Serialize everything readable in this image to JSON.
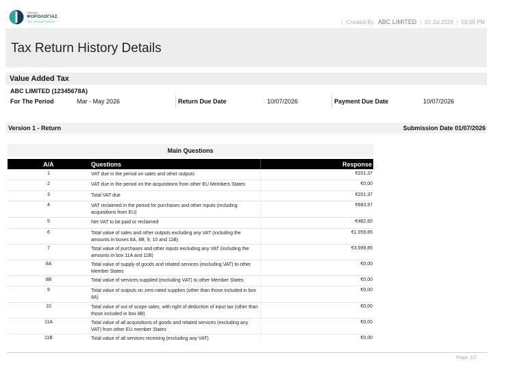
{
  "header": {
    "logo": {
      "line1": "ΤΜΗΜΑ",
      "line2": "ΦΟΡΟΛΟΓΙΑΣ",
      "line3": "TAX DEPARTMENT"
    },
    "created_by_label": "Created By",
    "created_by_value": "ABC LIMITED",
    "date": "01 Jul 2026",
    "time": "01:06 PM",
    "separator": "|"
  },
  "page_title": "Tax Return History Details",
  "section_title": "Value Added Tax",
  "company": "ABC LIMITED (12345678A)",
  "period": {
    "period_label": "For The Period",
    "period_value": "Mar - May 2026",
    "return_due_label": "Return Due Date",
    "return_due_value": "10/07/2026",
    "payment_due_label": "Payment Due Date",
    "payment_due_value": "10/07/2026"
  },
  "version": {
    "label": "Version 1 - Return",
    "submission": "Submission Date 01/07/2026"
  },
  "main_questions": {
    "title": "Main Questions",
    "columns": {
      "aa": "A/A",
      "questions": "Questions",
      "response": "Response"
    },
    "rows": [
      {
        "aa": "1",
        "question": "VAT due in the period on sales and other outputs",
        "response": "€201,37"
      },
      {
        "aa": "2",
        "question": "VAT due in the period on the acquisitions from other EU Members States",
        "response": "€0,00"
      },
      {
        "aa": "3",
        "question": "Total VAT due",
        "response": "€201,37"
      },
      {
        "aa": "4",
        "question": "VAT reclaimed in the period for purchases and other inputs (including acquisitions from EU)",
        "response": "€683,97"
      },
      {
        "aa": "5",
        "question": "Net VAT to be paid or reclaimed",
        "response": "-€482,60"
      },
      {
        "aa": "6",
        "question": "Total value of sales and other outputs excluding any VAT (including the amounts in boxes 8A, 8B, 9, 10 and 11B)",
        "response": "€1.059,85"
      },
      {
        "aa": "7",
        "question": "Total value of purchases and other inputs excluding any VAT (including the amounts in box 11A and 11B)",
        "response": "€3.599,85"
      },
      {
        "aa": "8A",
        "question": "Total value of supply of goods and related services (excluding VAT) to other Member States",
        "response": "€0,00"
      },
      {
        "aa": "8B",
        "question": "Total value of services supplied (excluding VAT) to other Member States",
        "response": "€0,00"
      },
      {
        "aa": "9",
        "question": "Total value of outputs on zero-rated supplies (other than those included in box 8A)",
        "response": "€0,00"
      },
      {
        "aa": "10",
        "question": "Total value of out of scope sales, with right of deduction of input tax (other than those included in box 8B)",
        "response": "€0,00"
      },
      {
        "aa": "11A",
        "question": "Total value of all acquisitions of goods and related services (excluding any VAT) from other EU member States",
        "response": "€0,00"
      },
      {
        "aa": "11B",
        "question": "Total value of all services receiving (excluding any VAT)",
        "response": "€0,00"
      }
    ]
  },
  "footer": {
    "page": "Page: 1/2"
  },
  "colors": {
    "teal": "#2aa3a8",
    "navy": "#1b3a5a",
    "band": "#ededed",
    "table_header": "#000000"
  }
}
